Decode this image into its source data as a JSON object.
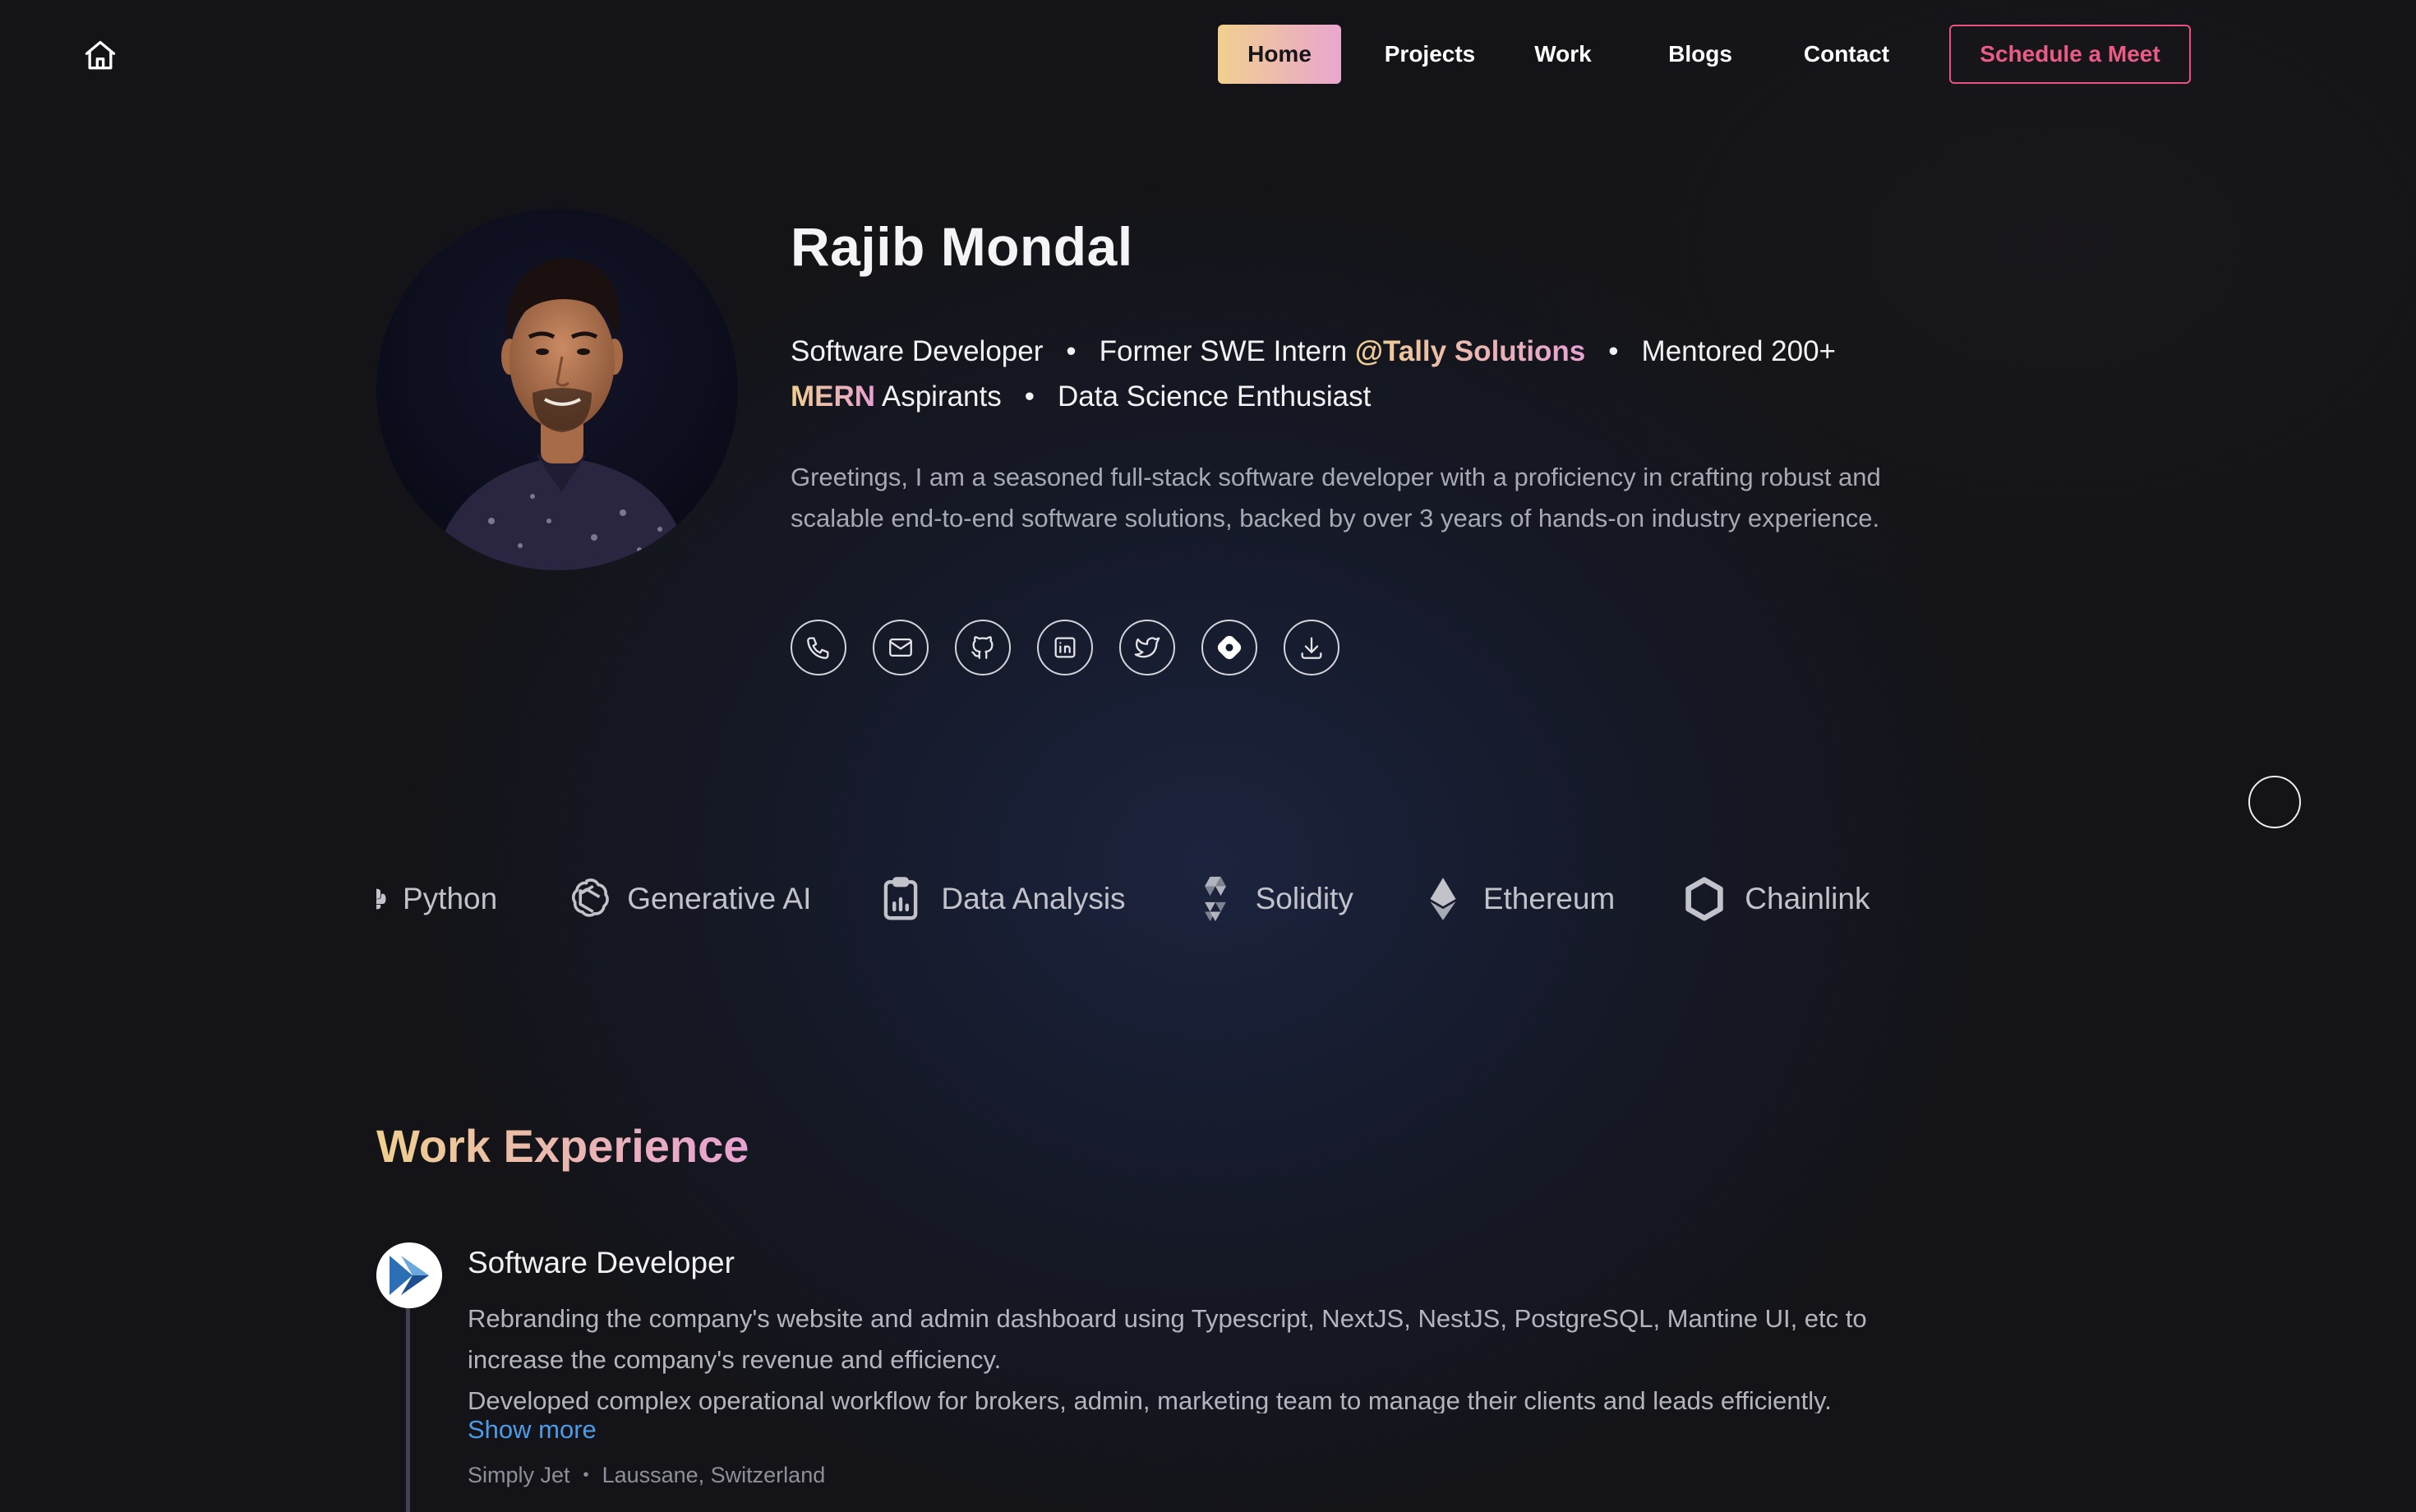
{
  "nav": {
    "home_icon": "home-icon",
    "items": [
      "Home",
      "Projects",
      "Work",
      "Blogs",
      "Contact"
    ],
    "cta": "Schedule a Meet"
  },
  "hero": {
    "name": "Rajib Mondal",
    "tagline": {
      "part1": "Software Developer",
      "part2": "Former SWE Intern ",
      "highlight1": "@Tally Solutions",
      "part3": "Mentored 200+",
      "highlight2": "MERN",
      "part4": " Aspirants",
      "part5": "Data Science Enthusiast",
      "separator": "•"
    },
    "bio": "Greetings, I am a seasoned full-stack software developer with a proficiency in crafting robust and scalable end-to-end software solutions, backed by over 3 years of hands-on industry experience.",
    "socials": [
      "phone-icon",
      "mail-icon",
      "github-icon",
      "linkedin-icon",
      "twitter-icon",
      "hashnode-icon",
      "download-icon"
    ]
  },
  "skills": [
    {
      "label": "Python",
      "icon": "python-icon"
    },
    {
      "label": "Generative AI",
      "icon": "openai-icon"
    },
    {
      "label": "Data Analysis",
      "icon": "clipboard-chart-icon"
    },
    {
      "label": "Solidity",
      "icon": "solidity-icon"
    },
    {
      "label": "Ethereum",
      "icon": "ethereum-icon"
    },
    {
      "label": "Chainlink",
      "icon": "chainlink-icon"
    }
  ],
  "work_experience": {
    "title": "Work Experience",
    "jobs": [
      {
        "title": "Software Developer",
        "desc1": "Rebranding the company's website and admin dashboard using Typescript, NextJS, NestJS, PostgreSQL, Mantine UI, etc to increase the company's revenue and efficiency.",
        "desc2": "Developed complex operational workflow for brokers, admin, marketing team to manage their clients and leads efficiently.",
        "show_more": "Show more",
        "company": "Simply Jet",
        "location": "Laussane, Switzerland"
      }
    ]
  },
  "colors": {
    "accent_gold": "#efcf8f",
    "accent_pink": "#e7a0d1",
    "cta_red": "#ec5b86",
    "link_blue": "#4c9be8"
  }
}
